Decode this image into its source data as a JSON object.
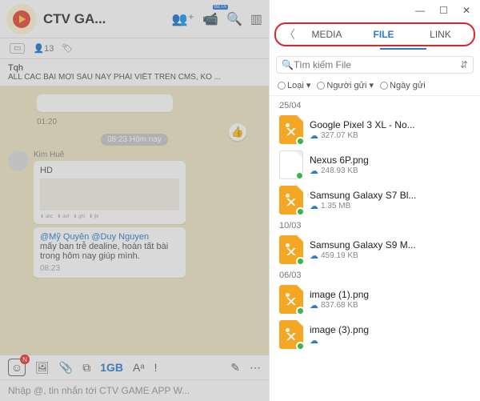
{
  "header": {
    "title": "CTV GA...",
    "members": "13"
  },
  "pinned": {
    "name": "Tqh",
    "text": "ALL CÁC BÀI MỚI SAU NÀY PHẢI VIẾT TRÊN CMS, KO ..."
  },
  "chat": {
    "time1": "01:20",
    "day": "08:23 Hôm nay",
    "user": "Kim Huê",
    "hd": "HD",
    "mention1": "@Mỹ Quyên",
    "mention2": "@Duy Nguyen",
    "body": "mấy ban trễ dealine, hoàn tất bài trong hôm nay giúp mình.",
    "stamp": "08:23"
  },
  "composer": {
    "gb": "1GB",
    "placeholder": "Nhập @, tin nhắn tới CTV GAME APP W..."
  },
  "tabs": {
    "media": "MEDIA",
    "file": "FILE",
    "link": "LINK"
  },
  "search": {
    "placeholder": "Tìm kiếm File"
  },
  "filters": {
    "type": "Loại",
    "sender": "Người gửi",
    "date": "Ngày gửi"
  },
  "groups": [
    {
      "date": "25/04",
      "files": [
        {
          "name": "Google Pixel 3 XL - No...",
          "size": "327.07 KB",
          "orange": true
        },
        {
          "name": "Nexus 6P.png",
          "size": "248.93 KB",
          "orange": false
        },
        {
          "name": "Samsung Galaxy S7 Bl...",
          "size": "1.35 MB",
          "orange": true
        }
      ]
    },
    {
      "date": "10/03",
      "files": [
        {
          "name": "Samsung Galaxy S9 M...",
          "size": "459.19 KB",
          "orange": true
        }
      ]
    },
    {
      "date": "06/03",
      "files": [
        {
          "name": "image (1).png",
          "size": "837.68 KB",
          "orange": true
        },
        {
          "name": "image (3).png",
          "size": "",
          "orange": true
        }
      ]
    }
  ]
}
